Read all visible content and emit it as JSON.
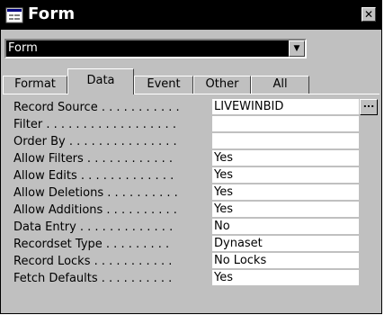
{
  "window": {
    "title": "Form",
    "icon": "form-icon",
    "close_glyph": "✕"
  },
  "selector": {
    "value": "Form",
    "arrow_glyph": "▼"
  },
  "tabs": [
    {
      "label": "Format",
      "active": false
    },
    {
      "label": "Data",
      "active": true
    },
    {
      "label": "Event",
      "active": false
    },
    {
      "label": "Other",
      "active": false
    },
    {
      "label": "All",
      "active": false
    }
  ],
  "properties": [
    {
      "label": "Record Source . . . . . . . . . . .",
      "value": "LIVEWINBID",
      "has_builder": true
    },
    {
      "label": "Filter . . . . . . . . . . . . . . . . . .",
      "value": ""
    },
    {
      "label": "Order By . . . . . . . . . . . . . . .",
      "value": ""
    },
    {
      "label": "Allow Filters . . . . . . . . . . . .",
      "value": "Yes"
    },
    {
      "label": "Allow Edits . . . . . . . . . . . . .",
      "value": "Yes"
    },
    {
      "label": "Allow Deletions . . . . . . . . . .",
      "value": "Yes"
    },
    {
      "label": "Allow Additions . . . . . . . . . .",
      "value": "Yes"
    },
    {
      "label": "Data Entry . . . . . . . . . . . . .",
      "value": "No"
    },
    {
      "label": "Recordset Type . . . . . . . . .",
      "value": "Dynaset"
    },
    {
      "label": "Record Locks . . . . . . . . . . .",
      "value": "No Locks"
    },
    {
      "label": "Fetch Defaults . . . . . . . . . .",
      "value": "Yes"
    }
  ],
  "builder_glyph": "...",
  "colors": {
    "titlebar": "#000000",
    "face": "#c0c0c0",
    "field": "#ffffff"
  }
}
